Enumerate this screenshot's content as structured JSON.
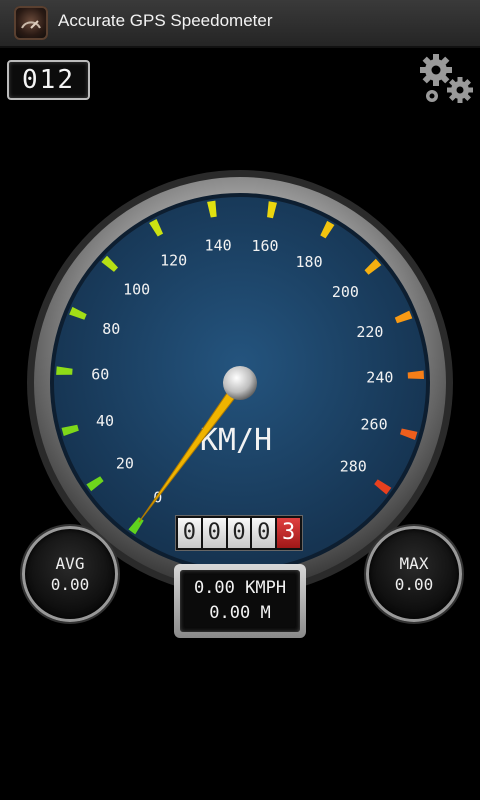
{
  "app": {
    "title": "Accurate GPS Speedometer",
    "icon": "speedometer-app-icon"
  },
  "satellites": {
    "value": "012"
  },
  "settings": {
    "icon": "gears-icon"
  },
  "gauge": {
    "unit_label": "KM/H",
    "max_speed": 280,
    "current_speed": 0,
    "tick_labels": [
      "0",
      "20",
      "40",
      "60",
      "80",
      "100",
      "120",
      "140",
      "160",
      "180",
      "200",
      "220",
      "240",
      "260",
      "280"
    ],
    "face_color": "#1d4468",
    "needle_color": "#f0b400"
  },
  "odometer": {
    "digits": [
      "0",
      "0",
      "0",
      "0",
      "3"
    ]
  },
  "avg": {
    "label": "AVG",
    "value": "0.00"
  },
  "max": {
    "label": "MAX",
    "value": "0.00"
  },
  "readout": {
    "speed": "0.00 KMPH",
    "distance": "0.00 M"
  }
}
